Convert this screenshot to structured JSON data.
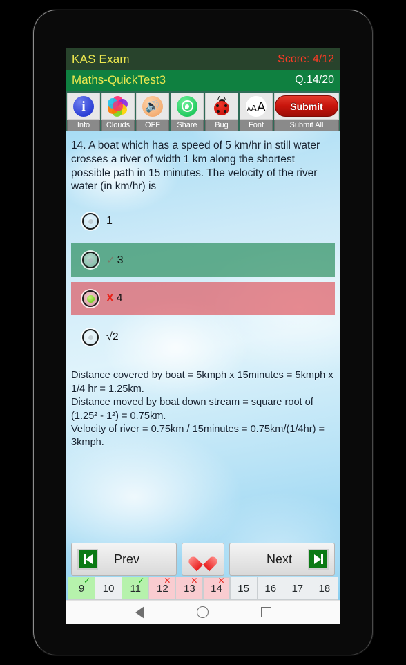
{
  "app": {
    "title": "KAS Exam",
    "score_label": "Score:",
    "score_value": "4/12",
    "test_title": "Maths-QuickTest3",
    "question_counter": "Q.14/20"
  },
  "toolbar": {
    "buttons": [
      {
        "icon": "info-icon",
        "label": "Info"
      },
      {
        "icon": "clouds-icon",
        "label": "Clouds"
      },
      {
        "icon": "speaker-off-icon",
        "label": "OFF"
      },
      {
        "icon": "share-whatsapp-icon",
        "label": "Share"
      },
      {
        "icon": "bug-icon",
        "label": "Bug"
      },
      {
        "icon": "font-size-icon",
        "label": "Font"
      }
    ],
    "submit_button": "Submit",
    "submit_all_label": "Submit All",
    "clouds_colors": [
      "#ff2d72",
      "#ffd400",
      "#22c0e8",
      "#8a2be2",
      "#7ed321",
      "#ff7a00"
    ]
  },
  "question": {
    "text": "14. A boat which has a speed of 5 km/hr in still water crosses a river of width 1 km along the shortest possible path in 15 minutes. The velocity of the river water (in km/hr) is",
    "options": [
      {
        "text": "1",
        "state": "none",
        "mark": "",
        "selected": false
      },
      {
        "text": "3",
        "state": "correct",
        "mark": "✓",
        "selected": false
      },
      {
        "text": "4",
        "state": "wrong",
        "mark": "X",
        "selected": true
      },
      {
        "text": "√2",
        "state": "none",
        "mark": "",
        "selected": false
      }
    ],
    "explanation": "Distance covered by boat = 5kmph x 15minutes = 5kmph x 1/4 hr = 1.25km.\nDistance moved by boat down stream = square root of (1.25² - 1²) = 0.75km.\nVelocity of river = 0.75km / 15minutes = 0.75km/(1/4hr) = 3kmph."
  },
  "nav": {
    "prev_label": "Prev",
    "next_label": "Next",
    "favorite_icon": "heart-icon",
    "prev_icon": "skip-previous-icon",
    "next_icon": "skip-next-icon"
  },
  "question_strip": [
    {
      "number": "9",
      "state": "ok",
      "mark": "✓"
    },
    {
      "number": "10",
      "state": "neutral",
      "mark": ""
    },
    {
      "number": "11",
      "state": "ok",
      "mark": "✓"
    },
    {
      "number": "12",
      "state": "bad",
      "mark": "✕"
    },
    {
      "number": "13",
      "state": "bad",
      "mark": "✕"
    },
    {
      "number": "14",
      "state": "bad",
      "mark": "✕"
    },
    {
      "number": "15",
      "state": "neutral",
      "mark": ""
    },
    {
      "number": "16",
      "state": "neutral",
      "mark": ""
    },
    {
      "number": "17",
      "state": "neutral",
      "mark": ""
    },
    {
      "number": "18",
      "state": "neutral",
      "mark": ""
    }
  ],
  "system_nav": {
    "back": "back-icon",
    "home": "home-icon",
    "recents": "recents-icon"
  },
  "colors": {
    "titlebar": "#28432c",
    "subbar": "#0f8040",
    "title_text": "#ede84f",
    "score_text": "#ff3b26",
    "toolbar_bg": "#2f6b57",
    "correct_row": "#288c5a",
    "wrong_row": "#de464e",
    "submit_red": "#c8150c"
  }
}
